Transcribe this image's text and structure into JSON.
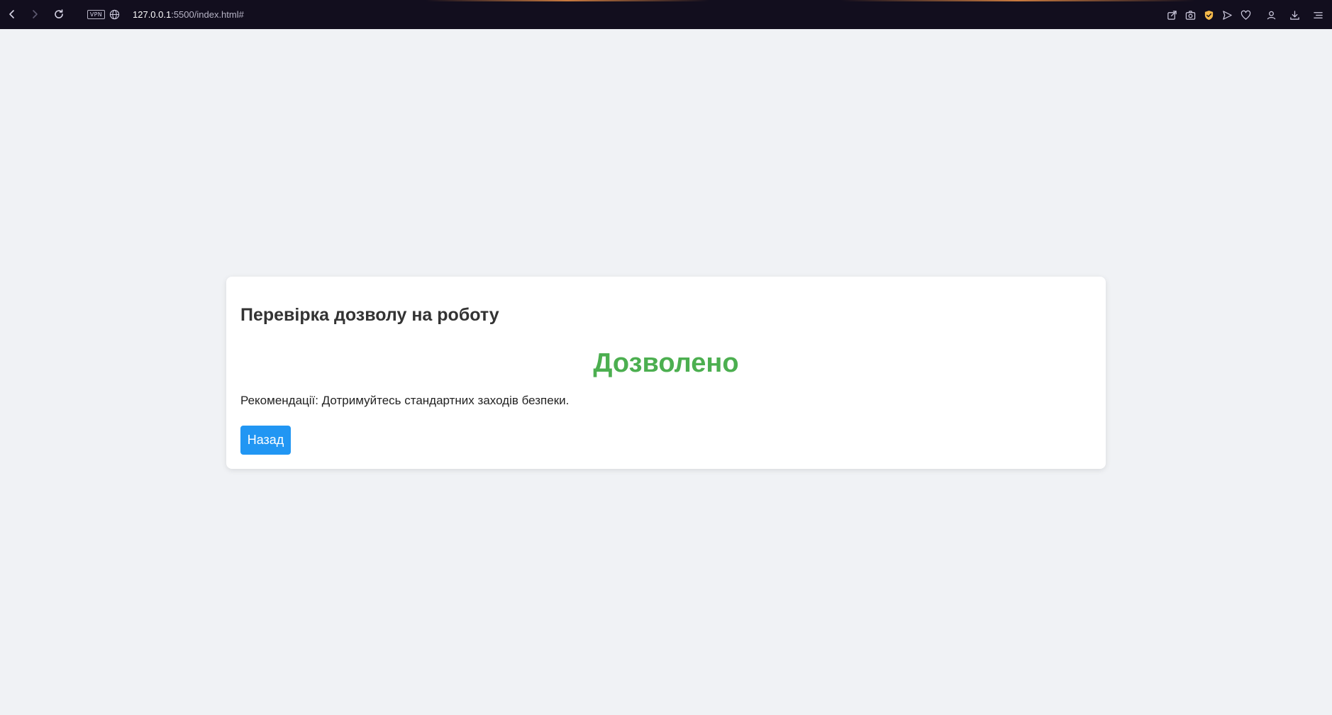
{
  "browser": {
    "url_host": "127.0.0.1",
    "url_path": ":5500/index.html#",
    "vpn_label": "VPN",
    "icons": [
      "back-icon",
      "forward-icon",
      "reload-icon",
      "vpn-badge",
      "globe-icon",
      "share-icon",
      "camera-icon",
      "shield-icon",
      "send-icon",
      "heart-icon",
      "user-icon",
      "download-icon",
      "menu-icon"
    ],
    "colors": {
      "toolbar_bg": "#120e1e",
      "shield": "#f5b94a"
    }
  },
  "page": {
    "title": "Перевірка дозволу на роботу",
    "status": "Дозволено",
    "recommendation": "Рекомендації: Дотримуйтесь стандартних заходів безпеки.",
    "back_label": "Назад",
    "colors": {
      "background": "#f0f2f5",
      "status": "#4caf50",
      "button": "#2196f3"
    }
  }
}
